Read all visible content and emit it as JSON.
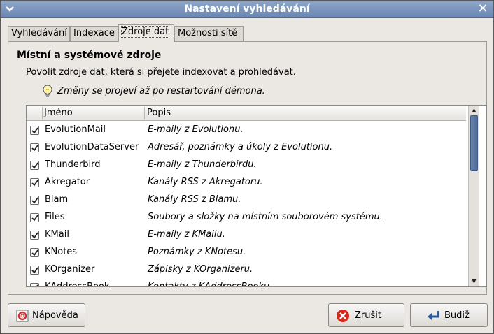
{
  "window": {
    "title": "Nastavení vyhledávání"
  },
  "tabs": [
    {
      "label": "Vyhledávání",
      "active": false
    },
    {
      "label": "Indexace",
      "active": false
    },
    {
      "label": "Zdroje dat",
      "active": true
    },
    {
      "label": "Možnosti sítě",
      "active": false
    }
  ],
  "section": {
    "title": "Místní a systémové zdroje",
    "description": "Povolit zdroje dat, která si přejete indexovat a prohledávat.",
    "hint": "Změny se projeví až po restartování démona."
  },
  "table": {
    "columns": [
      "Jméno",
      "Popis"
    ],
    "rows": [
      {
        "name": "EvolutionMail",
        "description": "E-maily z Evolutionu.",
        "checked": true
      },
      {
        "name": "EvolutionDataServer",
        "description": "Adresář, poznámky a úkoly z Evolutionu.",
        "checked": true
      },
      {
        "name": "Thunderbird",
        "description": "E-maily z Thunderbirdu.",
        "checked": true
      },
      {
        "name": "Akregator",
        "description": "Kanály RSS z Akregatoru.",
        "checked": true
      },
      {
        "name": "Blam",
        "description": "Kanály RSS z Blamu.",
        "checked": true
      },
      {
        "name": "Files",
        "description": "Soubory a složky na místním souborovém systému.",
        "checked": true
      },
      {
        "name": "KMail",
        "description": "E-maily z KMailu.",
        "checked": true
      },
      {
        "name": "KNotes",
        "description": "Poznámky z KNotesu.",
        "checked": true
      },
      {
        "name": "KOrganizer",
        "description": "Zápisky z KOrganizeru.",
        "checked": true
      },
      {
        "name": "KAddressBook",
        "description": "Kontakty z KAddressBooku.",
        "checked": true
      }
    ]
  },
  "buttons": {
    "help": {
      "mnemonic": "N",
      "rest": "ápověda",
      "icon": "help-icon"
    },
    "cancel": {
      "mnemonic": "Z",
      "rest": "rušit",
      "icon": "cancel-icon"
    },
    "close": {
      "mnemonic": "B",
      "rest": "udiž",
      "icon": "close-enter-icon"
    }
  },
  "colors": {
    "titlebar": "#6a86b2",
    "scroll_thumb": "#4a6a9c",
    "cancel_icon": "#d9261c"
  }
}
